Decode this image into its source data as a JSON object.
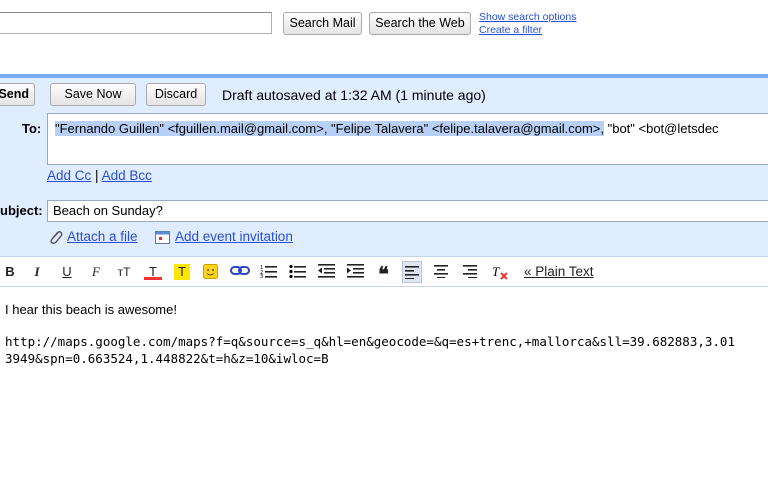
{
  "search": {
    "search_mail_label": "Search Mail",
    "search_web_label": "Search the Web",
    "show_options_label": "Show search options",
    "create_filter_label": "Create a filter"
  },
  "actions": {
    "send_label": "Send",
    "save_now_label": "Save Now",
    "discard_label": "Discard",
    "autosave_status": "Draft autosaved at 1:32 AM (1 minute ago)"
  },
  "compose": {
    "to_label": "To:",
    "to_selected": "\"Fernando Guillen\" <fguillen.mail@gmail.com>, \"Felipe Talavera\" <felipe.talavera@gmail.com>,",
    "to_rest": " \"bot\" <bot@letsdec",
    "add_cc": "Add Cc",
    "separator": "|",
    "add_bcc": "Add Bcc",
    "subject_label": "ubject:",
    "subject_value": "Beach on Sunday?",
    "attach_label": "Attach a file",
    "event_label": "Add event invitation"
  },
  "format_toolbar": {
    "bold": "B",
    "italic": "I",
    "underline": "U",
    "font": "F",
    "size": "тT",
    "text_color": "T",
    "highlight": "T",
    "plain_text": "« Plain Text"
  },
  "message": {
    "line1": "I hear this beach is awesome!",
    "line2": "http://maps.google.com/maps?f=q&source=s_q&hl=en&geocode=&q=es+trenc,+mallorca&sll=39.682883,3.01",
    "line3": "3949&spn=0.663524,1.448822&t=h&z=10&iwloc=B"
  },
  "colors": {
    "compose_bg": "#e0ecff",
    "accent_bar": "#7baaf7",
    "link": "#2a4ed8",
    "selection": "#b8d0f5"
  }
}
